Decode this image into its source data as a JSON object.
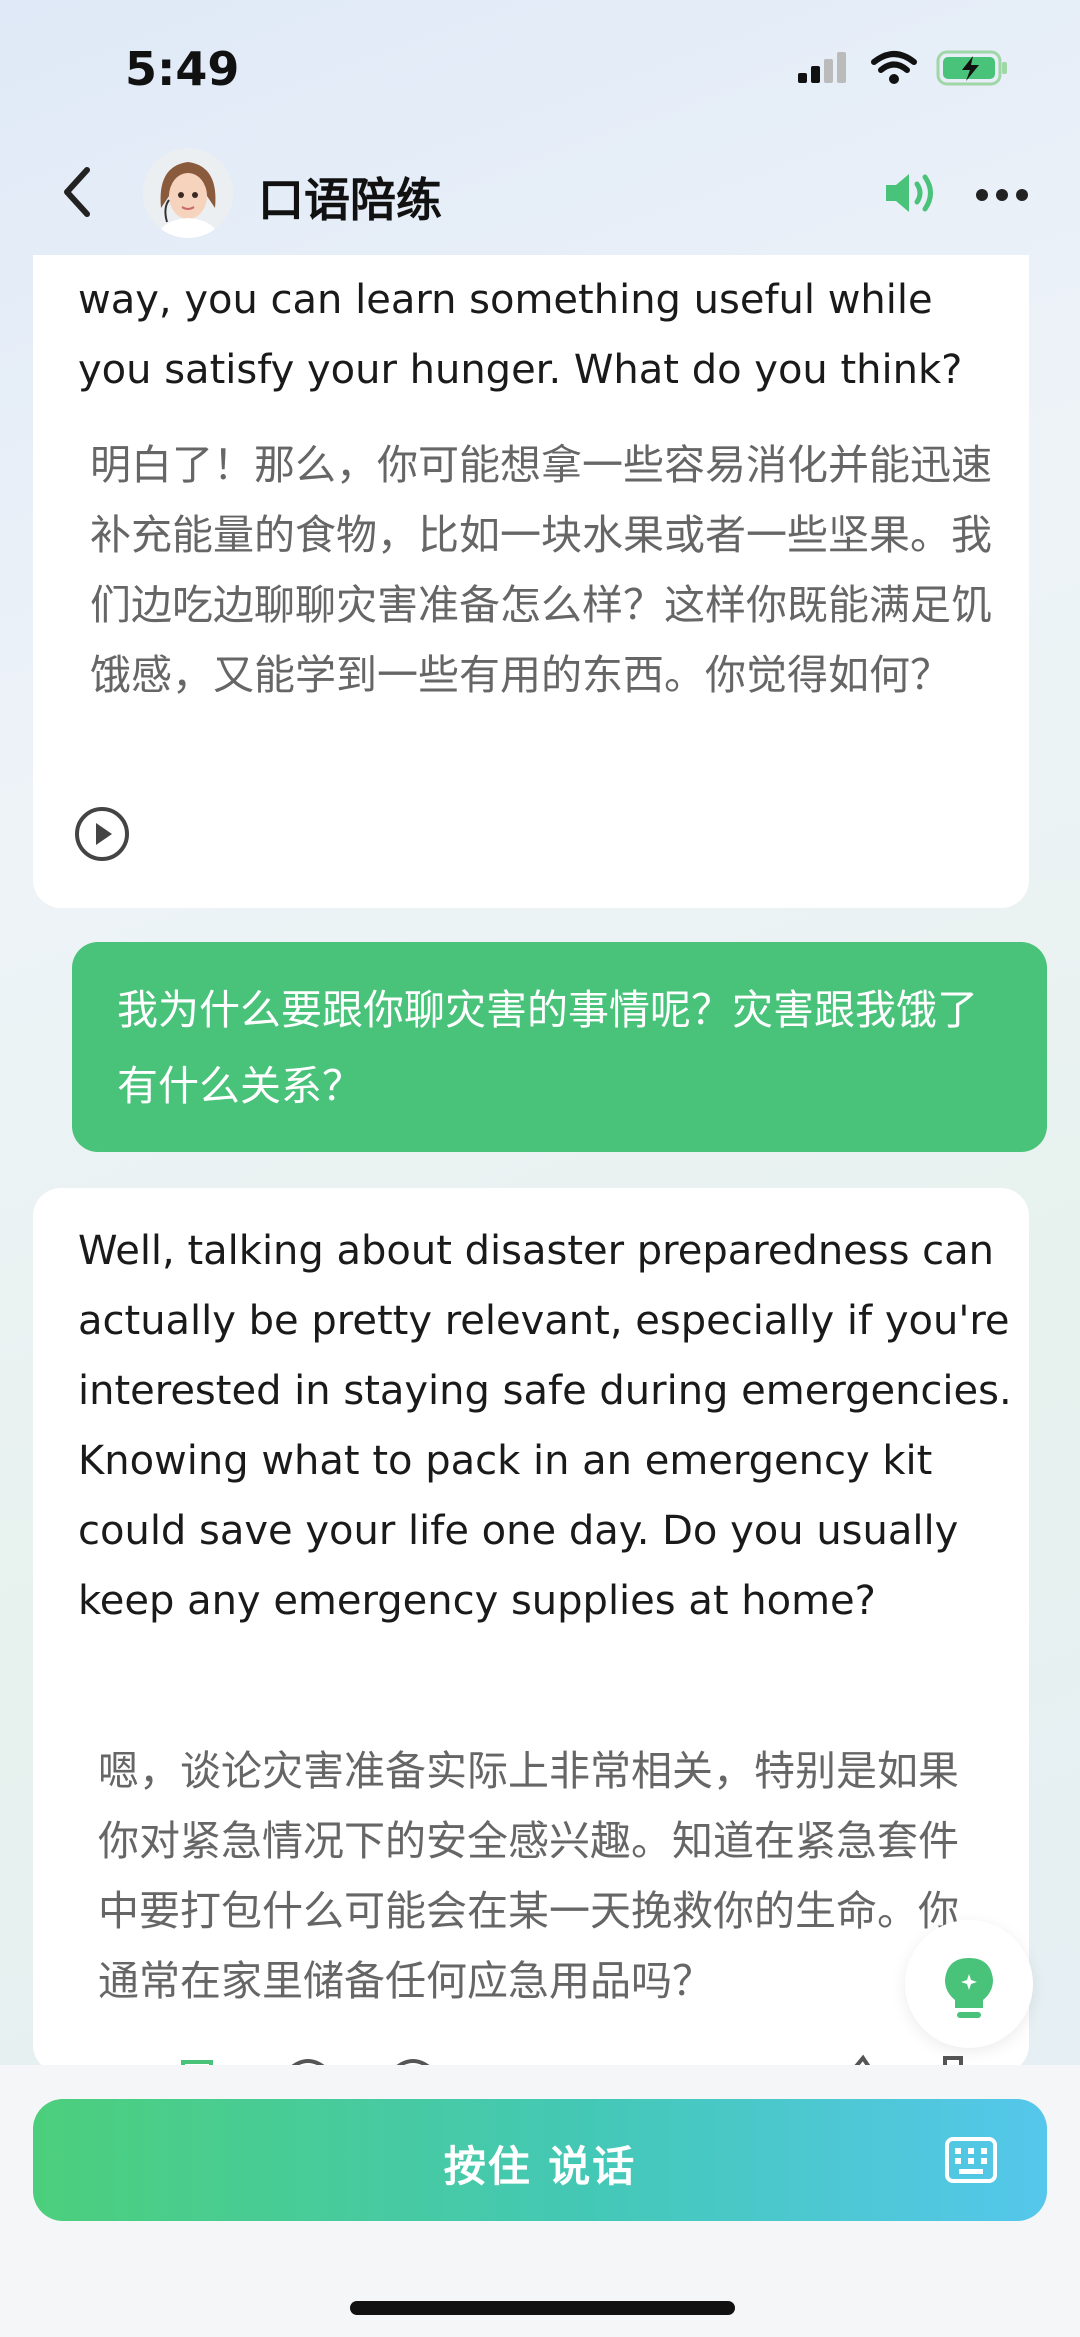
{
  "status": {
    "time": "5:49"
  },
  "nav": {
    "title": "口语陪练",
    "back_icon": "chevron-left-icon",
    "speaker_icon": "speaker-icon",
    "more_icon": "more-icon",
    "accent": "#49c27a"
  },
  "messages": [
    {
      "role": "ai",
      "en": "way, you can learn something useful while you satisfy your hunger. What do you think?",
      "zh": "明白了！那么，你可能想拿一些容易消化并能迅速补充能量的食物，比如一块水果或者一些坚果。我们边吃边聊聊灾害准备怎么样？这样你既能满足饥饿感，又能学到一些有用的东西。你觉得如何？"
    },
    {
      "role": "user",
      "text": "我为什么要跟你聊灾害的事情呢？灾害跟我饿了有什么关系？"
    },
    {
      "role": "ai",
      "en": "Well, talking about disaster preparedness can actually be pretty relevant, especially if you're interested in staying safe during emergencies. Knowing what to pack in an emergency kit could save your life one day. Do you usually keep any emergency supplies at home?",
      "zh": "嗯，谈论灾害准备实际上非常相关，特别是如果你对紧急情况下的安全感兴趣。知道在紧急套件中要打包什么可能会在某一天挽救你的生命。你通常在家里储备任何应急用品吗？"
    }
  ],
  "bottom": {
    "hold_to_talk_label": "按住 说话",
    "keyboard_icon": "keyboard-icon"
  },
  "hint_icon": "lightbulb-icon"
}
